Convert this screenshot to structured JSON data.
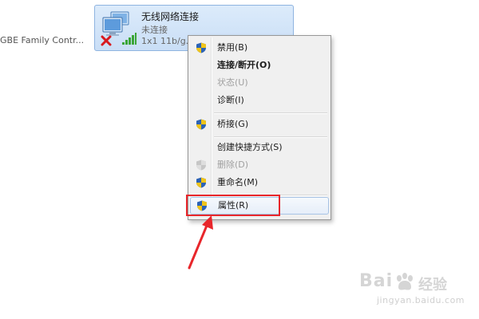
{
  "adapters": {
    "left_label": "GBE Family Contr...",
    "wireless": {
      "name": "无线网络连接",
      "status": "未连接",
      "device": "1x1 11b/g..."
    }
  },
  "context_menu": {
    "items": [
      {
        "label": "禁用(B)",
        "shield": true,
        "bold": false,
        "disabled": false
      },
      {
        "label": "连接/断开(O)",
        "shield": false,
        "bold": true,
        "disabled": false
      },
      {
        "label": "状态(U)",
        "shield": false,
        "bold": false,
        "disabled": true
      },
      {
        "label": "诊断(I)",
        "shield": false,
        "bold": false,
        "disabled": false
      },
      {
        "label": "桥接(G)",
        "shield": true,
        "bold": false,
        "disabled": false
      },
      {
        "label": "创建快捷方式(S)",
        "shield": false,
        "bold": false,
        "disabled": false
      },
      {
        "label": "删除(D)",
        "shield": true,
        "bold": false,
        "disabled": true
      },
      {
        "label": "重命名(M)",
        "shield": true,
        "bold": false,
        "disabled": false
      },
      {
        "label": "属性(R)",
        "shield": true,
        "bold": false,
        "disabled": false,
        "highlighted": true
      }
    ]
  },
  "icons": {
    "adapter": "wireless-network-adapter-icon",
    "disconnected": "red-x-icon",
    "signal": "signal-bars-icon",
    "shield": "uac-shield-icon",
    "arrow": "red-arrow-icon"
  },
  "colors": {
    "highlight": "#e8262b",
    "tile_selected": "#c9def6"
  },
  "watermark": {
    "brand": "Bai",
    "suffix": "经验",
    "url": "jingyan.baidu.com"
  }
}
